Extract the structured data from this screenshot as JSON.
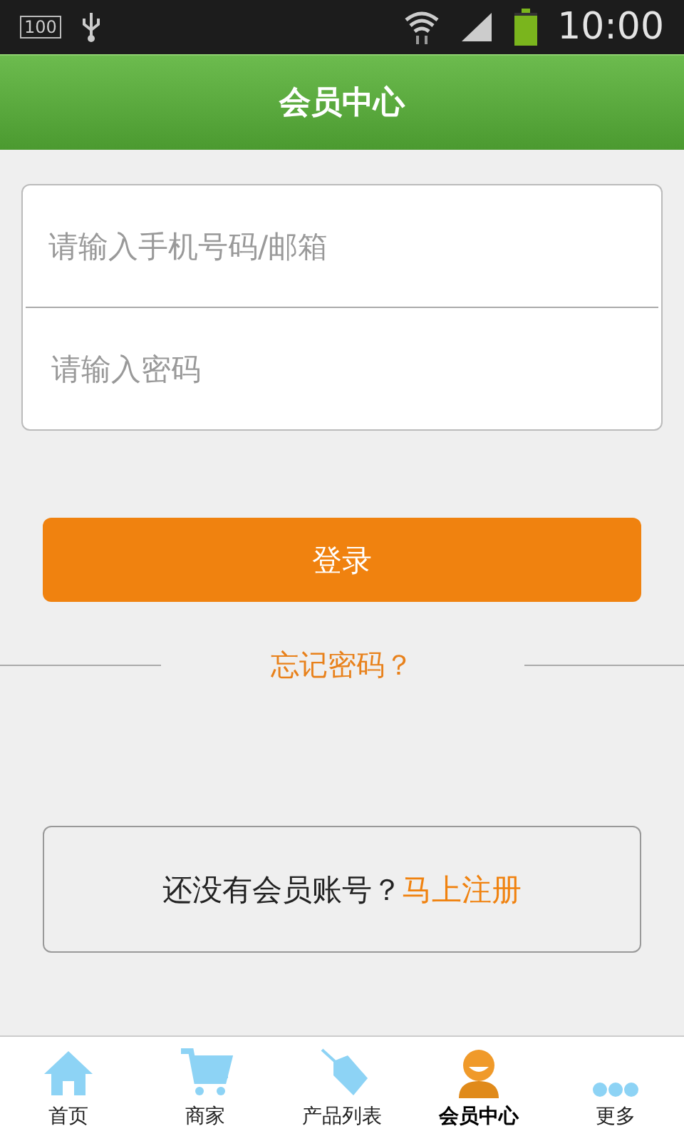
{
  "status_bar": {
    "battery_text": "100",
    "time": "10:00"
  },
  "header": {
    "title": "会员中心"
  },
  "form": {
    "fields": [
      {
        "placeholder": "请输入手机号码/邮箱"
      },
      {
        "placeholder": "请输入密码"
      }
    ],
    "login_button": "登录",
    "forgot_link": "忘记密码？"
  },
  "register": {
    "text": "还没有会员账号？",
    "link": "马上注册"
  },
  "nav": [
    {
      "label": "首页",
      "kind": "home",
      "selected": false
    },
    {
      "label": "商家",
      "kind": "cart",
      "selected": false
    },
    {
      "label": "产品列表",
      "kind": "tag",
      "selected": false
    },
    {
      "label": "会员中心",
      "kind": "user",
      "selected": true
    },
    {
      "label": "更多",
      "kind": "more",
      "selected": false
    }
  ]
}
